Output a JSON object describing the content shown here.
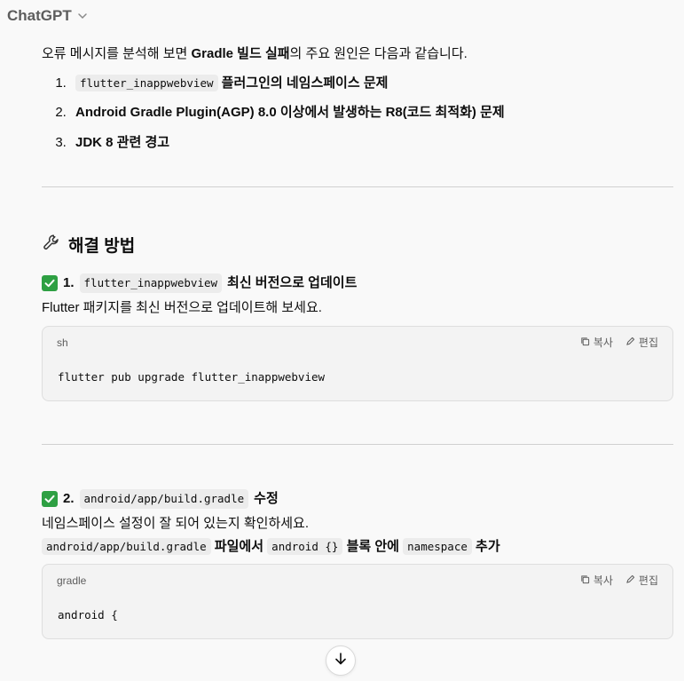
{
  "header": {
    "model_name": "ChatGPT"
  },
  "message": {
    "intro": {
      "prefix": "오류 메시지를 분석해 보면 ",
      "bold": "Gradle 빌드 실패",
      "suffix": "의 주요 원인은 다음과 같습니다."
    },
    "causes": [
      {
        "code": "flutter_inappwebview",
        "text": " 플러그인의 네임스페이스 문제"
      },
      {
        "code": "",
        "text": "Android Gradle Plugin(AGP) 8.0 이상에서 발생하는 R8(코드 최적화) 문제"
      },
      {
        "code": "",
        "text": "JDK 8 관련 경고"
      }
    ],
    "solution_title": "해결 방법",
    "step1": {
      "number": "1.",
      "code": "flutter_inappwebview",
      "title_suffix": "최신 버전으로 업데이트",
      "desc": "Flutter 패키지를 최신 버전으로 업데이트해 보세요.",
      "codeblock": {
        "lang": "sh",
        "copy_label": "복사",
        "edit_label": "편집",
        "code": "flutter pub upgrade flutter_inappwebview"
      }
    },
    "step2": {
      "number": "2.",
      "code": "android/app/build.gradle",
      "title_suffix": "수정",
      "desc": "네임스페이스 설정이 잘 되어 있는지 확인하세요.",
      "instruction": {
        "code1": "android/app/build.gradle",
        "text1": " 파일에서 ",
        "code2": "android {}",
        "text2": " 블록 안에 ",
        "code3": "namespace",
        "text3": " 추가"
      },
      "codeblock": {
        "lang": "gradle",
        "copy_label": "복사",
        "edit_label": "편집",
        "code": "android {"
      }
    }
  },
  "colors": {
    "background": "#f9f9f9",
    "check_green": "#2ea043",
    "code_bg": "#ececec"
  }
}
